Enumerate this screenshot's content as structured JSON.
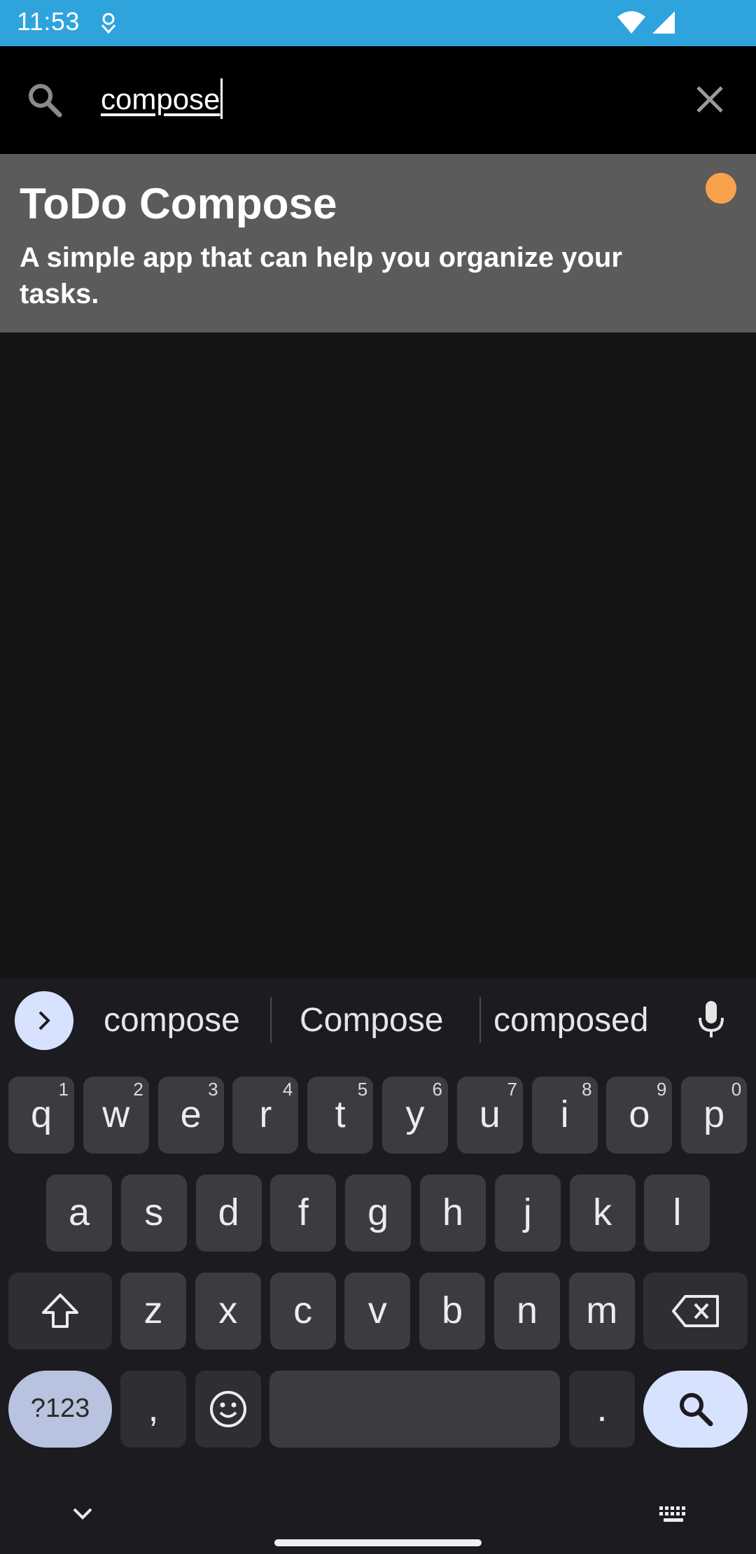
{
  "status_bar": {
    "time": "11:53",
    "background": "#2fa3dc",
    "icons": [
      "download-icon",
      "wifi-icon",
      "signal-icon"
    ]
  },
  "search": {
    "query": "compose",
    "icons": [
      "search-icon",
      "close-icon"
    ]
  },
  "results": [
    {
      "title": "ToDo Compose",
      "description": "A simple app that can help you organize your tasks.",
      "priority_color": "#f8a34c"
    }
  ],
  "keyboard": {
    "suggestions": [
      "compose",
      "Compose",
      "composed"
    ],
    "rows": [
      [
        {
          "label": "q",
          "hint": "1"
        },
        {
          "label": "w",
          "hint": "2"
        },
        {
          "label": "e",
          "hint": "3"
        },
        {
          "label": "r",
          "hint": "4"
        },
        {
          "label": "t",
          "hint": "5"
        },
        {
          "label": "y",
          "hint": "6"
        },
        {
          "label": "u",
          "hint": "7"
        },
        {
          "label": "i",
          "hint": "8"
        },
        {
          "label": "o",
          "hint": "9"
        },
        {
          "label": "p",
          "hint": "0"
        }
      ],
      [
        {
          "label": "a"
        },
        {
          "label": "s"
        },
        {
          "label": "d"
        },
        {
          "label": "f"
        },
        {
          "label": "g"
        },
        {
          "label": "h"
        },
        {
          "label": "j"
        },
        {
          "label": "k"
        },
        {
          "label": "l"
        }
      ],
      [
        {
          "label": "z"
        },
        {
          "label": "x"
        },
        {
          "label": "c"
        },
        {
          "label": "v"
        },
        {
          "label": "b"
        },
        {
          "label": "n"
        },
        {
          "label": "m"
        }
      ]
    ],
    "symbols_label": "?123",
    "comma_label": ",",
    "period_label": ".",
    "accent_color": "#d7e2ff"
  }
}
